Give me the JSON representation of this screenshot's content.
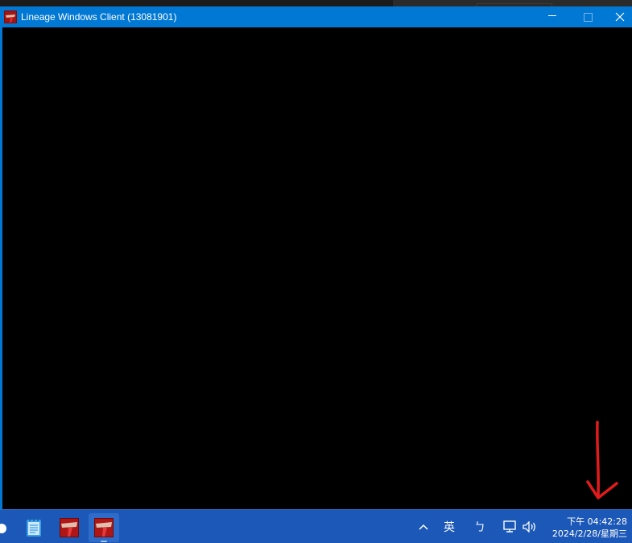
{
  "window": {
    "title": "Lineage Windows Client (13081901)",
    "app_icon": "lineage-app-icon",
    "accent": "#0078d4",
    "client_background": "#000000"
  },
  "controls": {
    "minimize": "minimize-icon",
    "maximize": "maximize-icon",
    "close": "close-icon"
  },
  "annotation": {
    "color": "#e01b1b",
    "shape": "down-arrow"
  },
  "taskbar": {
    "background": "#1c58b8",
    "apps": [
      {
        "name": "notepad",
        "icon": "notepad-icon"
      },
      {
        "name": "lineage",
        "icon": "lineage-icon",
        "label": "Lineage"
      },
      {
        "name": "lineage-active",
        "icon": "lineage-icon",
        "label": "Lineage"
      }
    ],
    "tray": {
      "overflow_icon": "chevron-up-icon",
      "ime_mode": "英",
      "ime_symbol": "ㄅ",
      "network_icon": "network-icon",
      "volume_icon": "volume-icon"
    },
    "clock": {
      "time": "下午 04:42:28",
      "date": "2024/2/28/星期三"
    }
  }
}
